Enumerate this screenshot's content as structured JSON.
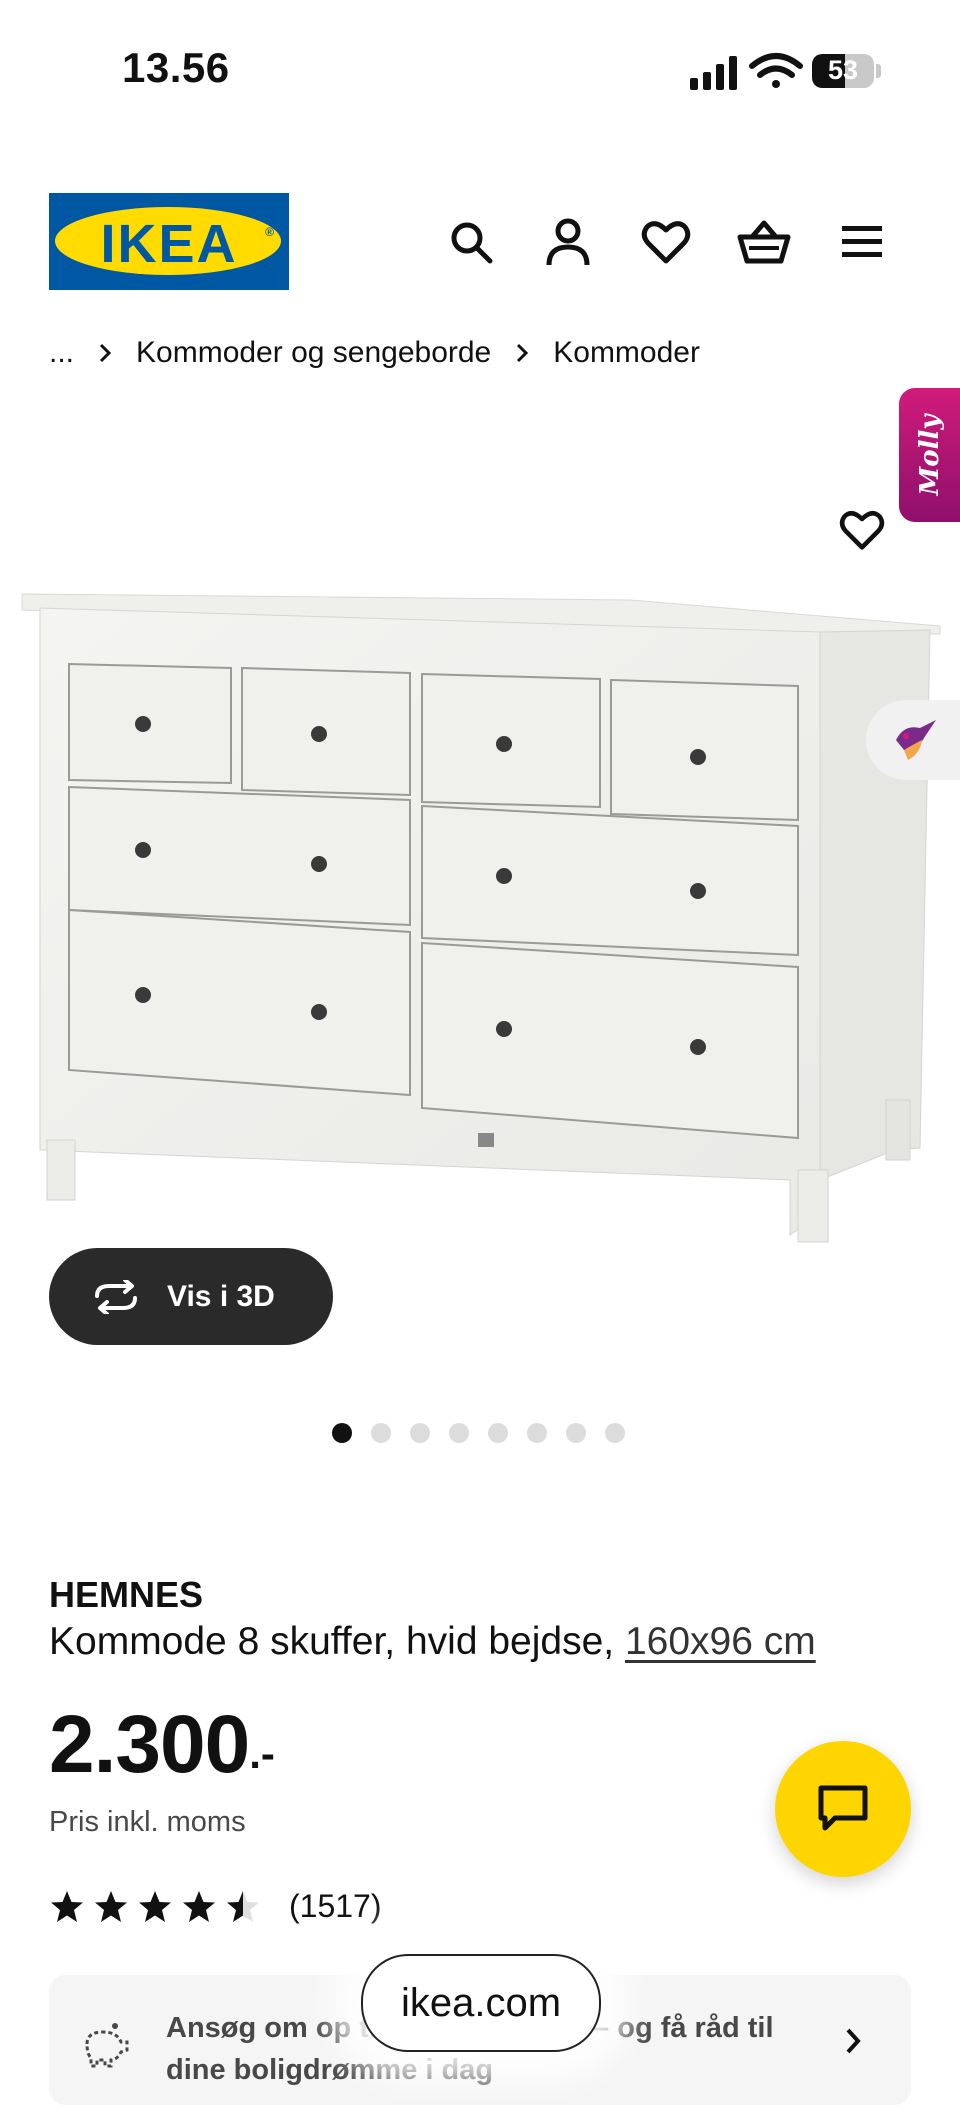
{
  "status_bar": {
    "time": "13.56",
    "battery_level": "53"
  },
  "header": {
    "logo_text": "IKEA",
    "icons": [
      "search-icon",
      "profile-icon",
      "heart-icon",
      "basket-icon",
      "menu-icon"
    ]
  },
  "breadcrumb": {
    "ellipsis": "...",
    "items": [
      "Kommoder og sengeborde",
      "Kommoder"
    ]
  },
  "molly_tab": {
    "label": "Molly"
  },
  "gallery": {
    "view_3d_label": "Vis i 3D",
    "dot_count": 8,
    "active_dot": 0
  },
  "product": {
    "name": "HEMNES",
    "description": "Kommode 8 skuffer, hvid bejdse,",
    "size": "160x96 cm",
    "price": "2.300",
    "price_suffix": ".-",
    "price_note": "Pris inkl. moms",
    "rating": 4.5,
    "review_count": "(1517)"
  },
  "credit_banner": {
    "text": "Ansøg om op til 30.000 i kredit – og få råd til dine boligdrømme i dag"
  },
  "address_bar": {
    "url": "ikea.com"
  },
  "colors": {
    "ikea_blue": "#0058a3",
    "ikea_yellow": "#ffdb00",
    "chat_yellow": "#ffd500",
    "molly_magenta": "#d11b7a"
  }
}
